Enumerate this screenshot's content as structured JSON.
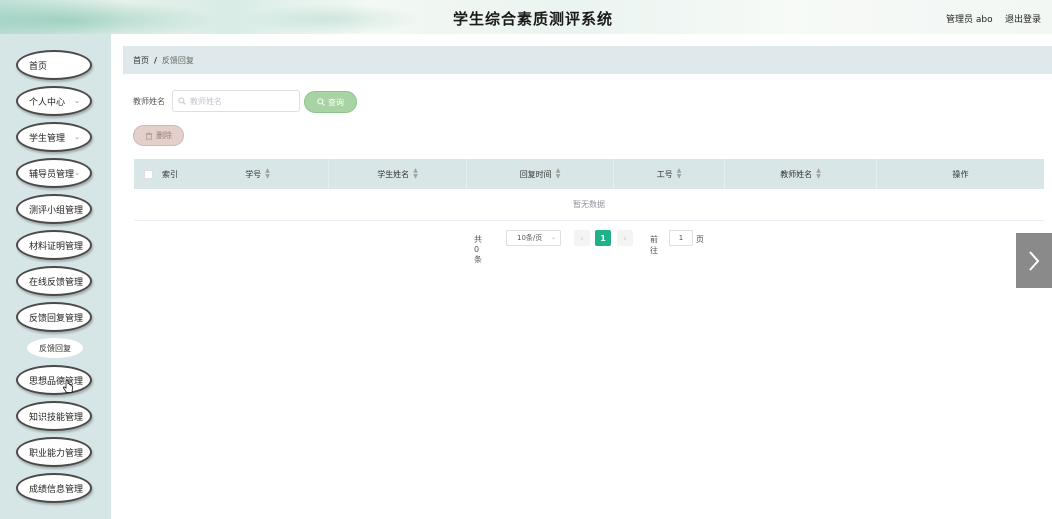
{
  "header": {
    "title": "学生综合素质测评系统",
    "admin_label": "管理员 abo",
    "logout_label": "退出登录"
  },
  "sidebar": {
    "items": [
      {
        "label": "首页",
        "has_arrow": false
      },
      {
        "label": "个人中心",
        "has_arrow": true
      },
      {
        "label": "学生管理",
        "has_arrow": true
      },
      {
        "label": "辅导员管理",
        "has_arrow": true
      },
      {
        "label": "测评小组管理",
        "has_arrow": false
      },
      {
        "label": "材料证明管理",
        "has_arrow": false
      },
      {
        "label": "在线反馈管理",
        "has_arrow": false
      },
      {
        "label": "反馈回复管理",
        "has_arrow": false
      },
      {
        "label": "思想品德管理",
        "has_arrow": false
      },
      {
        "label": "知识技能管理",
        "has_arrow": false
      },
      {
        "label": "职业能力管理",
        "has_arrow": false
      },
      {
        "label": "成绩信息管理",
        "has_arrow": false
      }
    ],
    "submenu": {
      "label": "反馈回复"
    }
  },
  "breadcrumb": {
    "home": "首页",
    "separator": "/",
    "current": "反馈回复"
  },
  "search": {
    "label": "教师姓名",
    "placeholder": "教师姓名",
    "value": "",
    "query_label": "查询"
  },
  "actions": {
    "delete_label": "删除"
  },
  "table": {
    "columns": [
      "索引",
      "学号",
      "学生姓名",
      "回复时间",
      "工号",
      "教师姓名",
      "操作"
    ],
    "empty_text": "暂无数据"
  },
  "pagination": {
    "total": "共 0 条",
    "page_size": "10条/页",
    "current_page": "1",
    "goto_label": "前往",
    "goto_value": "1",
    "unit": "页"
  },
  "colors": {
    "accent": "#1fb28a",
    "query_button": "#a8d4a5",
    "delete_button": "#e3cfcb",
    "sidebar_bg": "#d6e5e6",
    "table_header_bg": "#d8e6e8"
  }
}
